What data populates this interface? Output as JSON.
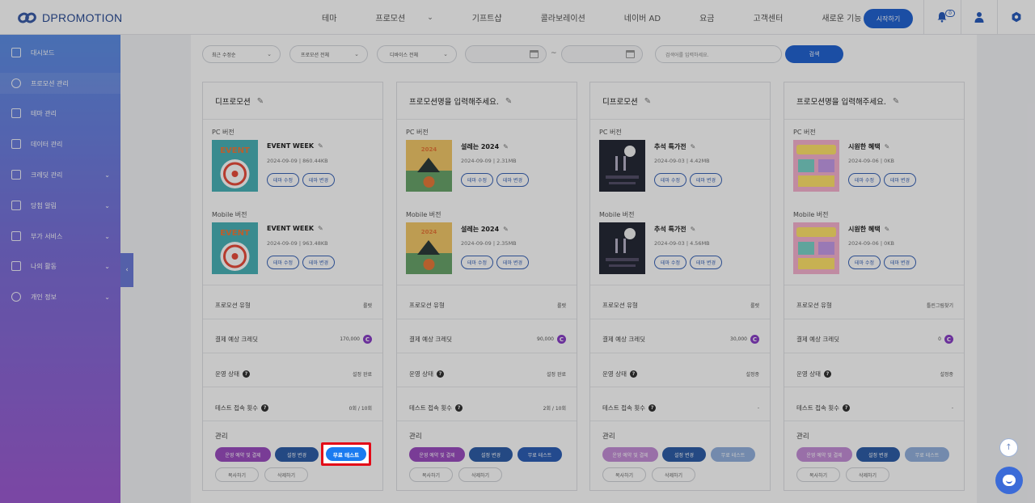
{
  "brand": "DPROMOTION",
  "topnav": [
    {
      "label": "테마",
      "chevron": false
    },
    {
      "label": "프로모션",
      "chevron": true
    },
    {
      "label": "기프트샵",
      "chevron": false
    },
    {
      "label": "콜라보레이션",
      "chevron": false
    },
    {
      "label": "네이버 AD",
      "chevron": false
    },
    {
      "label": "요금",
      "chevron": false
    },
    {
      "label": "고객센터",
      "chevron": false
    },
    {
      "label": "새로운 기능",
      "chevron": false
    }
  ],
  "header": {
    "start_label": "시작하기",
    "notif_count": "0"
  },
  "sidebar": {
    "items": [
      {
        "label": "대시보드",
        "icon": "dashboard-icon",
        "chevron": false
      },
      {
        "label": "프로모션 관리",
        "icon": "promotion-icon",
        "chevron": false
      },
      {
        "label": "테마 관리",
        "icon": "theme-icon",
        "chevron": false
      },
      {
        "label": "데이터 관리",
        "icon": "data-icon",
        "chevron": false
      },
      {
        "label": "크레딧 관리",
        "icon": "credit-icon",
        "chevron": true
      },
      {
        "label": "당첨 알림",
        "icon": "mail-icon",
        "chevron": true
      },
      {
        "label": "부가 서비스",
        "icon": "clipboard-icon",
        "chevron": true
      },
      {
        "label": "나의 활동",
        "icon": "edit-icon",
        "chevron": true
      },
      {
        "label": "개인 정보",
        "icon": "user-icon",
        "chevron": true
      }
    ],
    "collapse": "‹"
  },
  "filters": {
    "sort": "최근 수정순",
    "promo_type": "프로모션 전체",
    "device": "디바이스 전체",
    "search_placeholder": "검색어를 입력하세요.",
    "search_button": "검색",
    "range_sep": "~"
  },
  "labels": {
    "pc": "PC 버전",
    "mobile": "Mobile 버전",
    "edit_theme": "테마 수정",
    "change_theme": "테마 변경",
    "promo_type": "프로모션 유형",
    "expected_credit": "결제 예상 크레딧",
    "status": "운영 상태",
    "test_count": "테스트 접속 횟수",
    "manage": "관리",
    "reserve_pay": "운영 예약 및 결제",
    "change_settings": "설정 변경",
    "free_test": "무료 테스트",
    "copy": "복사하기",
    "delete": "삭제하기"
  },
  "cards": [
    {
      "title": "디프로모션",
      "pc": {
        "name": "EVENT WEEK",
        "meta": "2024-09-09 | 860.44KB"
      },
      "mobile": {
        "name": "EVENT WEEK",
        "meta": "2024-09-09 | 963.48KB"
      },
      "type": "룰렛",
      "credit": "170,000",
      "status": "설정 완료",
      "tests": "0회 / 10회",
      "thumb": "teal"
    },
    {
      "title": "프로모션명을 입력해주세요.",
      "pc": {
        "name": "설레는 2024",
        "meta": "2024-09-09 | 2.31MB"
      },
      "mobile": {
        "name": "설레는 2024",
        "meta": "2024-09-09 | 2.35MB"
      },
      "type": "룰렛",
      "credit": "90,000",
      "status": "설정 완료",
      "tests": "2회 / 10회",
      "thumb": "orange"
    },
    {
      "title": "디프로모션",
      "pc": {
        "name": "추석 특가전",
        "meta": "2024-09-03 | 4.42MB"
      },
      "mobile": {
        "name": "추석 특가전",
        "meta": "2024-09-03 | 4.56MB"
      },
      "type": "룰렛",
      "credit": "30,000",
      "status": "설정중",
      "tests": "-",
      "thumb": "dark"
    },
    {
      "title": "프로모션명을 입력해주세요.",
      "pc": {
        "name": "시원한 혜택",
        "meta": "2024-09-06 | 0KB"
      },
      "mobile": {
        "name": "시원한 혜택",
        "meta": "2024-09-06 | 0KB"
      },
      "type": "틀린그림찾기",
      "credit": "0",
      "status": "설정중",
      "tests": "-",
      "thumb": "pastel"
    }
  ],
  "colors": {
    "accent": "#2364d2",
    "highlight": "#e30a17",
    "credit": "#8a3fc7"
  }
}
